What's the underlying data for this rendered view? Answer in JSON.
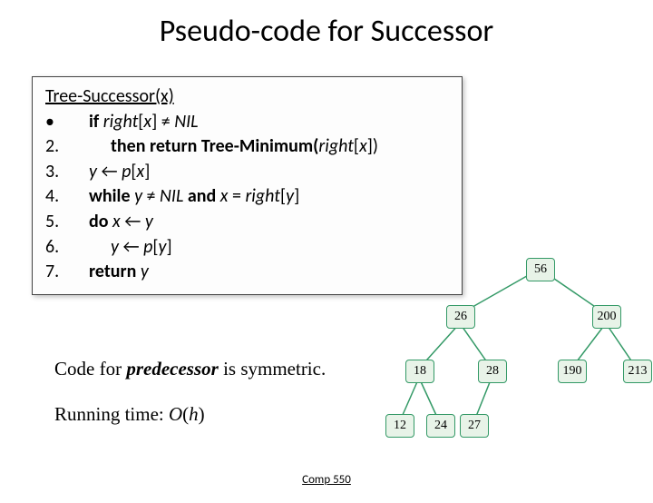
{
  "title": "Pseudo-code for Successor",
  "fn_name": "Tree-Successor(x)",
  "code": {
    "l1_num": "•",
    "l1_a": "if ",
    "l1_b": "right",
    "l1_c": "[",
    "l1_d": "x",
    "l1_e": "] ≠ ",
    "l1_f": "NIL",
    "l2_num": "2.",
    "l2_a": "then return Tree-Minimum(",
    "l2_b": "right",
    "l2_c": "[",
    "l2_d": "x",
    "l2_e": "])",
    "l3_num": "3.",
    "l3_a": "y",
    "l3_b": " ← ",
    "l3_c": "p",
    "l3_d": "[",
    "l3_e": "x",
    "l3_f": "]",
    "l4_num": "4.",
    "l4_a": "while ",
    "l4_b": "y",
    "l4_c": " ≠ ",
    "l4_d": "NIL",
    "l4_e": " and ",
    "l4_f": "x",
    "l4_g": " = ",
    "l4_h": "right",
    "l4_i": "[",
    "l4_j": "y",
    "l4_k": "]",
    "l5_num": "5.",
    "l5_a": "do ",
    "l5_b": "x",
    "l5_c": " ← ",
    "l5_d": "y",
    "l6_num": "6.",
    "l6_a": "y",
    "l6_b": " ← ",
    "l6_c": "p",
    "l6_d": "[",
    "l6_e": "y",
    "l6_f": "]",
    "l7_num": "7.",
    "l7_a": "return ",
    "l7_b": "y"
  },
  "caption1_a": "Code for ",
  "caption1_b": "predecessor",
  "caption1_c": " is symmetric.",
  "caption2_a": "Running time: ",
  "caption2_b": "O",
  "caption2_c": "(",
  "caption2_d": "h",
  "caption2_e": ")",
  "tree": {
    "n56": "56",
    "n26": "26",
    "n200": "200",
    "n18": "18",
    "n28": "28",
    "n190": "190",
    "n213": "213",
    "n12": "12",
    "n24": "24",
    "n27": "27"
  },
  "footer": "Comp 550"
}
